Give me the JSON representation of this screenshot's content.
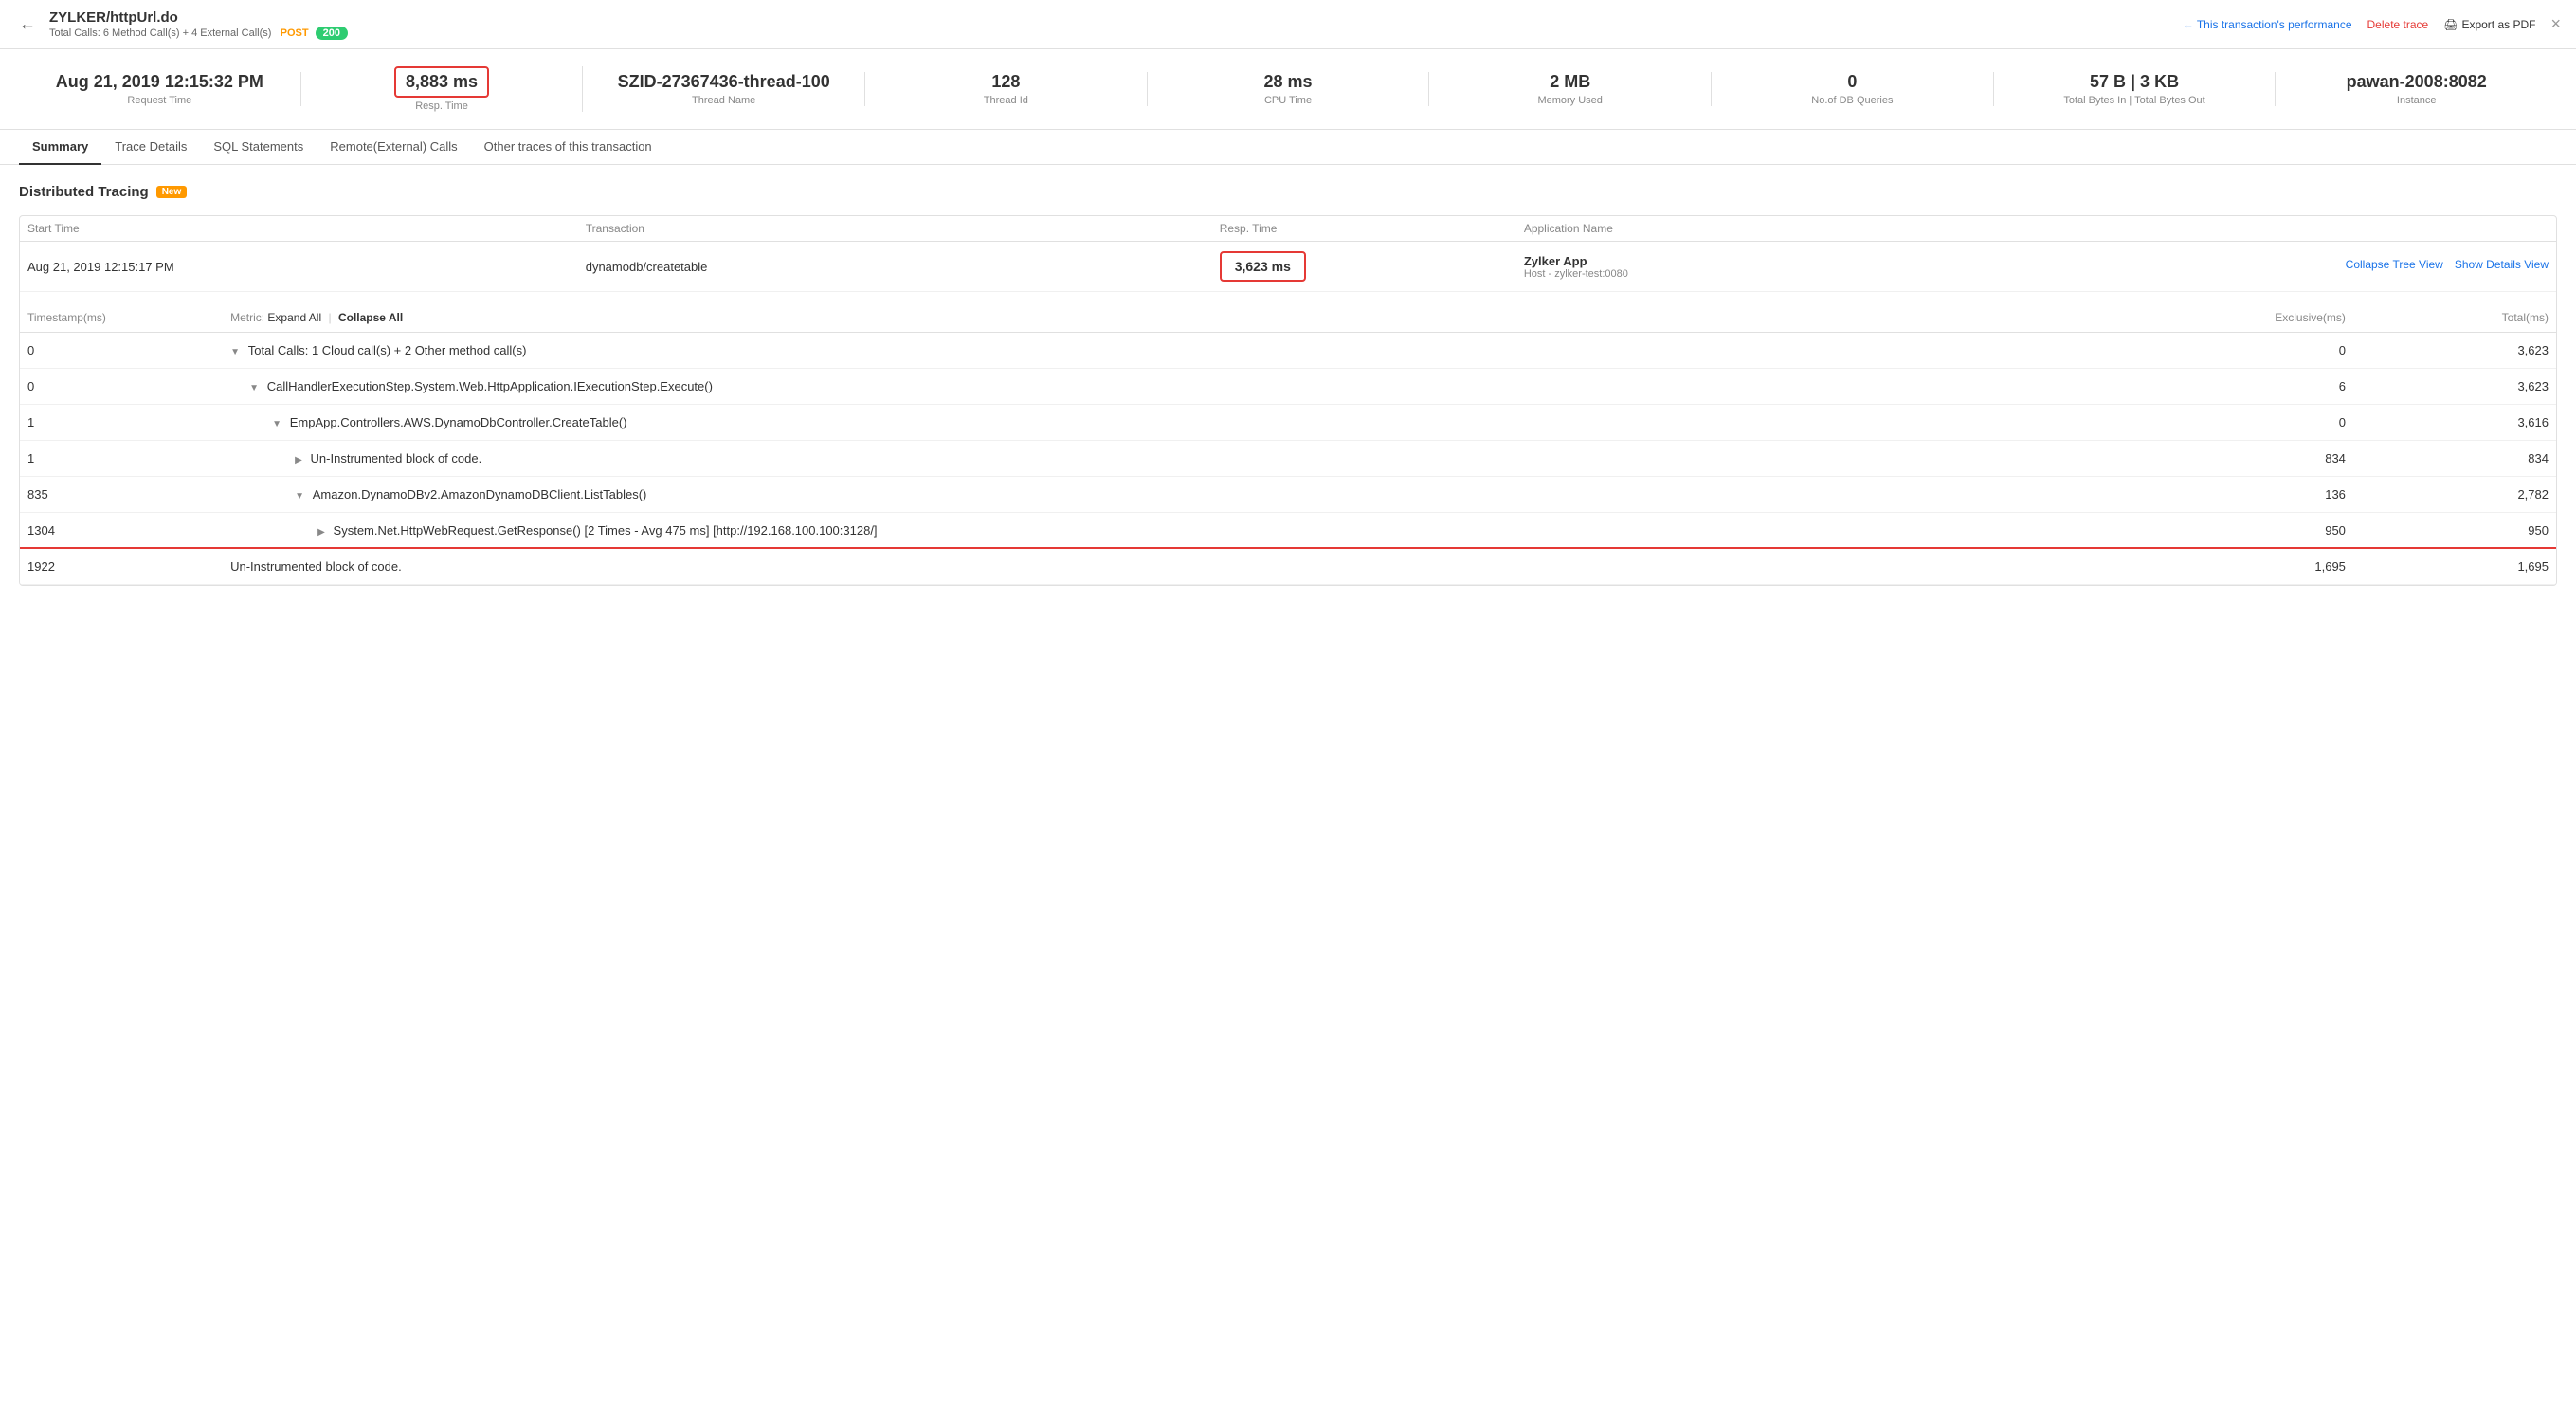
{
  "header": {
    "title": "ZYLKER/httpUrl.do",
    "subtitle": "Total Calls: 6 Method Call(s) + 4 External Call(s)",
    "method": "POST",
    "status_code": "200",
    "back_label": "←",
    "perf_link": "This transaction's performance",
    "delete_label": "Delete trace",
    "export_label": "Export as PDF",
    "close_label": "×"
  },
  "stats": [
    {
      "value": "Aug 21, 2019 12:15:32 PM",
      "label": "Request Time",
      "highlighted": false
    },
    {
      "value": "8,883 ms",
      "label": "Resp. Time",
      "highlighted": true
    },
    {
      "value": "SZID-27367436-thread-100",
      "label": "Thread Name",
      "highlighted": false
    },
    {
      "value": "128",
      "label": "Thread Id",
      "highlighted": false
    },
    {
      "value": "28 ms",
      "label": "CPU Time",
      "highlighted": false
    },
    {
      "value": "2 MB",
      "label": "Memory Used",
      "highlighted": false
    },
    {
      "value": "0",
      "label": "No.of DB Queries",
      "highlighted": false
    },
    {
      "value": "57 B | 3 KB",
      "label": "Total Bytes In | Total Bytes Out",
      "highlighted": false
    },
    {
      "value": "pawan-2008:8082",
      "label": "Instance",
      "highlighted": false
    }
  ],
  "tabs": [
    {
      "label": "Summary",
      "active": true
    },
    {
      "label": "Trace Details",
      "active": false
    },
    {
      "label": "SQL Statements",
      "active": false
    },
    {
      "label": "Remote(External) Calls",
      "active": false
    },
    {
      "label": "Other traces of this transaction",
      "active": false
    }
  ],
  "section_title": "Distributed Tracing",
  "section_badge": "New",
  "distributed_tracing": {
    "headers": [
      "Start Time",
      "Transaction",
      "Resp. Time",
      "Application Name"
    ],
    "row": {
      "start_time": "Aug 21, 2019 12:15:17 PM",
      "transaction": "dynamodb/createtable",
      "resp_time": "3,623 ms",
      "app_name": "Zylker App",
      "app_host": "Host - zylker-test:0080",
      "action_collapse": "Collapse Tree View",
      "action_details": "Show Details View"
    }
  },
  "trace_table": {
    "headers": {
      "timestamp": "Timestamp(ms)",
      "metric": "Metric:",
      "expand_all": "Expand All",
      "collapse_all": "Collapse All",
      "exclusive": "Exclusive(ms)",
      "total": "Total(ms)"
    },
    "rows": [
      {
        "timestamp": "0",
        "indent": 0,
        "icon": "▼",
        "metric": "Total Calls: 1 Cloud call(s) + 2 Other method call(s)",
        "exclusive": "0",
        "total": "3,623",
        "highlighted": false
      },
      {
        "timestamp": "0",
        "indent": 1,
        "icon": "▼",
        "metric": "CallHandlerExecutionStep.System.Web.HttpApplication.IExecutionStep.Execute()",
        "exclusive": "6",
        "total": "3,623",
        "highlighted": false
      },
      {
        "timestamp": "1",
        "indent": 2,
        "icon": "▼",
        "metric": "EmpApp.Controllers.AWS.DynamoDbController.CreateTable()",
        "exclusive": "0",
        "total": "3,616",
        "highlighted": false
      },
      {
        "timestamp": "1",
        "indent": 3,
        "icon": "▶",
        "metric": "Un-Instrumented block of code.",
        "exclusive": "834",
        "total": "834",
        "highlighted": false
      },
      {
        "timestamp": "835",
        "indent": 3,
        "icon": "▼",
        "metric": "Amazon.DynamoDBv2.AmazonDynamoDBClient.ListTables()",
        "exclusive": "136",
        "total": "2,782",
        "highlighted": false
      },
      {
        "timestamp": "1304",
        "indent": 4,
        "icon": "▶",
        "metric": "System.Net.HttpWebRequest.GetResponse() [2 Times - Avg 475 ms] [http://192.168.100.100:3128/]",
        "exclusive": "950",
        "total": "950",
        "highlighted": false
      },
      {
        "timestamp": "1922",
        "indent": 0,
        "icon": "",
        "metric": "Un-Instrumented block of code.",
        "exclusive": "1,695",
        "total": "1,695",
        "highlighted": true
      }
    ]
  }
}
